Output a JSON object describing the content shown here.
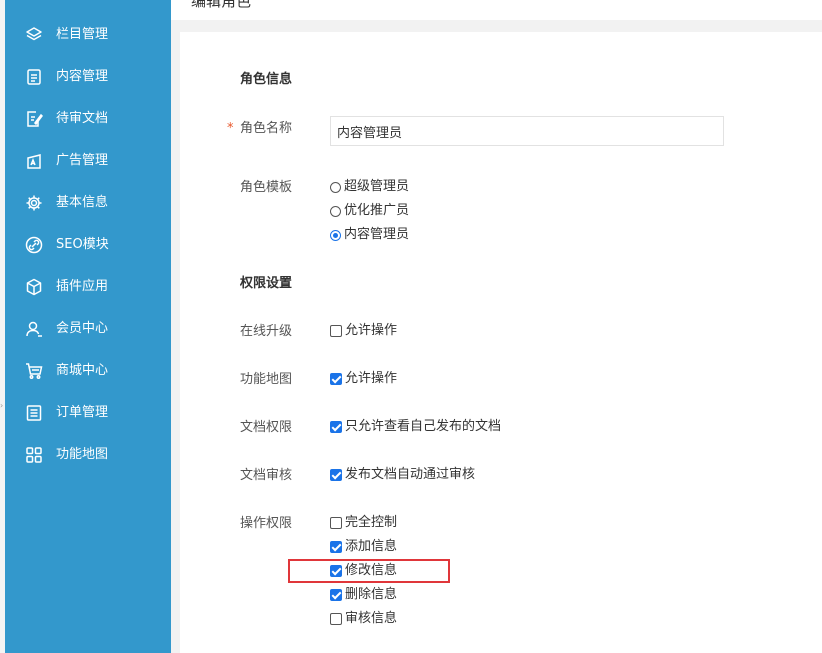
{
  "page_title": "编辑角色",
  "sidebar": {
    "items": [
      {
        "label": "栏目管理",
        "icon": "layers-icon"
      },
      {
        "label": "内容管理",
        "icon": "document-icon"
      },
      {
        "label": "待审文档",
        "icon": "edit-document-icon"
      },
      {
        "label": "广告管理",
        "icon": "ad-icon"
      },
      {
        "label": "基本信息",
        "icon": "gear-icon"
      },
      {
        "label": "SEO模块",
        "icon": "link-icon"
      },
      {
        "label": "插件应用",
        "icon": "cube-icon"
      },
      {
        "label": "会员中心",
        "icon": "user-icon"
      },
      {
        "label": "商城中心",
        "icon": "cart-icon"
      },
      {
        "label": "订单管理",
        "icon": "list-icon"
      },
      {
        "label": "功能地图",
        "icon": "grid-icon"
      }
    ]
  },
  "form": {
    "section_role": "角色信息",
    "required_mark": "*",
    "role_name_label": "角色名称",
    "role_name_value": "内容管理员",
    "template_label": "角色模板",
    "template_options": [
      {
        "label": "超级管理员",
        "selected": false
      },
      {
        "label": "优化推广员",
        "selected": false
      },
      {
        "label": "内容管理员",
        "selected": true
      }
    ],
    "section_permission": "权限设置",
    "online_upgrade_label": "在线升级",
    "online_upgrade_option": {
      "label": "允许操作",
      "checked": false
    },
    "function_map_label": "功能地图",
    "function_map_option": {
      "label": "允许操作",
      "checked": true
    },
    "doc_permission_label": "文档权限",
    "doc_permission_option": {
      "label": "只允许查看自己发布的文档",
      "checked": true
    },
    "doc_review_label": "文档审核",
    "doc_review_option": {
      "label": "发布文档自动通过审核",
      "checked": true
    },
    "op_permission_label": "操作权限",
    "op_options": [
      {
        "label": "完全控制",
        "checked": false
      },
      {
        "label": "添加信息",
        "checked": true
      },
      {
        "label": "修改信息",
        "checked": true
      },
      {
        "label": "删除信息",
        "checked": true
      },
      {
        "label": "审核信息",
        "checked": false
      }
    ]
  },
  "colors": {
    "sidebar_bg": "#3398cc",
    "checkbox_blue": "#1a73e8",
    "highlight_red": "#e0363a",
    "required_orange": "#e8562a"
  }
}
